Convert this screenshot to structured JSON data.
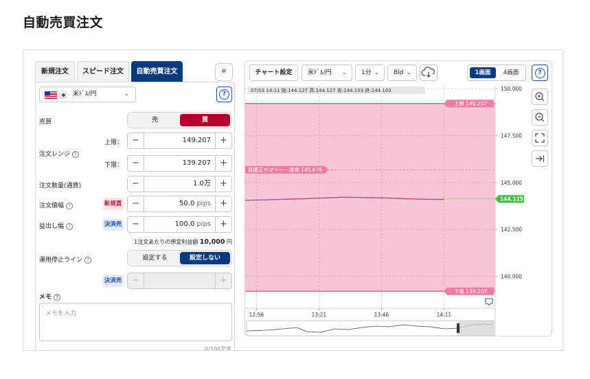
{
  "page": {
    "title": "自動売買注文"
  },
  "order": {
    "tabs": [
      {
        "label": "新規注文",
        "active": false
      },
      {
        "label": "スピード注文",
        "active": false
      },
      {
        "label": "自動売買注文",
        "active": true
      }
    ],
    "collapse_label": "«",
    "currency": {
      "label": "米ﾄﾞﾙ/円"
    },
    "side": {
      "label": "売買",
      "sell": "売",
      "buy": "買",
      "selected": "買"
    },
    "range": {
      "label": "注文レンジ",
      "upper_label": "上限：",
      "upper_value": "149.207",
      "lower_label": "下限：",
      "lower_value": "139.207"
    },
    "quantity": {
      "label": "注文数量(通貨)",
      "value": "1.0万"
    },
    "entry_width": {
      "label": "注文値幅",
      "tag": "新規買",
      "value": "50.0",
      "unit": "pips"
    },
    "take_profit": {
      "label": "益出し幅",
      "tag": "決済売",
      "value": "100.0",
      "unit": "pips"
    },
    "profit_note": {
      "text": "1注文あたりの想定利益額",
      "amount": "10,000",
      "unit": "円"
    },
    "stop_line": {
      "label": "運用停止ライン",
      "set": "設定する",
      "unset": "設定しない",
      "selected": "設定しない",
      "tag": "決済売"
    },
    "memo": {
      "label": "メモ",
      "placeholder": "メモを入力",
      "count": "0/100文字"
    }
  },
  "chart": {
    "toolbar": {
      "chart_settings": "チャート設定",
      "pair": "米ﾄﾞﾙ/円",
      "timeframe": "1分",
      "price_type": "Bid",
      "layout_single": "1画面",
      "layout_quad": "4画面"
    },
    "ohlc": {
      "time": "07/03 14:11",
      "open_label": "始:",
      "open": "144.127",
      "high_label": "高:",
      "high": "144.127",
      "low_label": "安:",
      "low": "144.103",
      "close_label": "終:",
      "close": "144.103"
    },
    "upper_line_label": "上限 149.207",
    "lower_line_label": "下限 139.207",
    "summary_label": "買建玉サマリー - 通常 145.676",
    "current_price": "144.125",
    "colors": {
      "band": "#f7c6d6",
      "limit_line": "#e8557a",
      "summary": "#f07ba0",
      "current": "#3cbf3c",
      "candle_line": "#c0405a",
      "avg_line": "#3b6ad0"
    }
  },
  "chart_data": {
    "type": "line",
    "x_tick_labels": [
      "12:56",
      "13:21",
      "13:46",
      "14:11"
    ],
    "y_tick_labels": [
      "150.000",
      "147.500",
      "145.000",
      "142.500",
      "140.000"
    ],
    "ylim": [
      138.3,
      150.15
    ],
    "upper_limit": 149.207,
    "lower_limit": 139.207,
    "summary_price": 145.676,
    "current_price": 144.125,
    "series": [
      {
        "x": [
          0,
          0.1,
          0.2,
          0.3,
          0.4,
          0.5,
          0.6,
          0.7,
          0.8,
          0.9,
          1.0
        ],
        "values": [
          144.06,
          144.08,
          144.11,
          144.14,
          144.18,
          144.22,
          144.2,
          144.18,
          144.14,
          144.11,
          144.1
        ]
      }
    ]
  }
}
